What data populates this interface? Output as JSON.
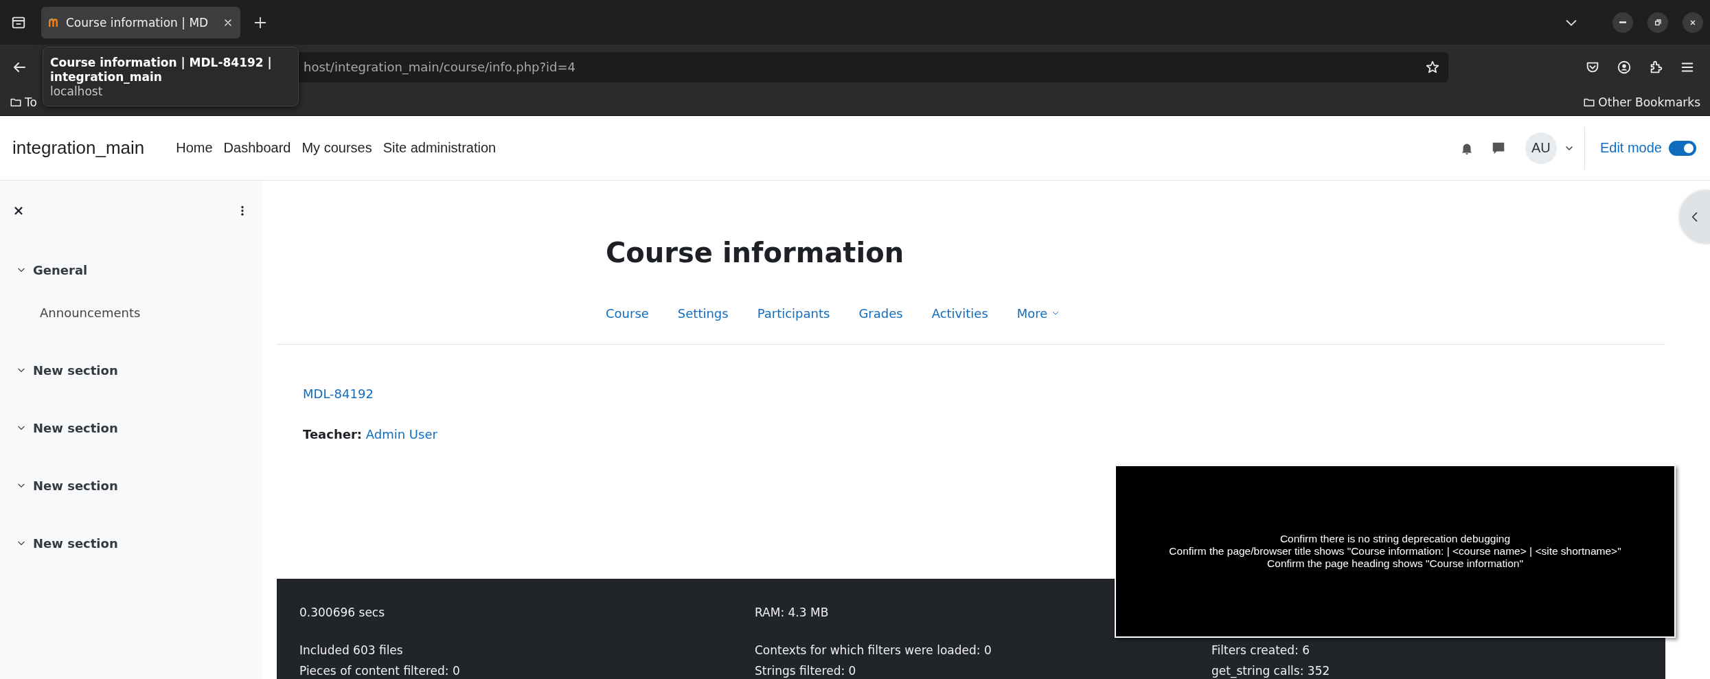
{
  "browser": {
    "tab": {
      "title": "Course information | MD",
      "selected": true
    },
    "tooltip": {
      "title": "Course information | MDL-84192 | integration_main",
      "host": "localhost"
    },
    "url": "host/integration_main/course/info.php?id=4",
    "bookmarks": [
      {
        "label": "To"
      }
    ],
    "other_bookmarks": "Other Bookmarks"
  },
  "navbar": {
    "site_name": "integration_main",
    "links": [
      "Home",
      "Dashboard",
      "My courses",
      "Site administration"
    ],
    "avatar": "AU",
    "edit_mode": {
      "label": "Edit mode",
      "on": true
    }
  },
  "drawer": {
    "sections": [
      {
        "title": "General",
        "expanded": true,
        "children": [
          {
            "title": "Announcements"
          }
        ]
      },
      {
        "title": "New section",
        "expanded": true
      },
      {
        "title": "New section",
        "expanded": true
      },
      {
        "title": "New section",
        "expanded": true
      },
      {
        "title": "New section",
        "expanded": true
      }
    ]
  },
  "page": {
    "heading": "Course information",
    "tabs": [
      {
        "label": "Course",
        "kind": "link"
      },
      {
        "label": "Settings",
        "kind": "link"
      },
      {
        "label": "Participants",
        "kind": "link"
      },
      {
        "label": "Grades",
        "kind": "link"
      },
      {
        "label": "Activities",
        "kind": "link"
      },
      {
        "label": "More",
        "kind": "menu"
      }
    ],
    "course_link": "MDL-84192",
    "teacher": {
      "label": "Teacher:",
      "name": "Admin User"
    }
  },
  "footer": {
    "rows": [
      [
        "0.300696 secs",
        "RAM: 4.3 MB"
      ],
      [
        "Included 603 files",
        "Contexts for which filters were loaded: 0",
        "Filters created: 6"
      ],
      [
        "Pieces of content filtered: 0",
        "Strings filtered: 0",
        "get_string calls: 352"
      ]
    ]
  },
  "overlay": {
    "lines": [
      "Confirm there is no string deprecation debugging",
      "Confirm the page/browser title shows \"Course information: | <course name> | <site shortname>\"",
      "Confirm the page heading shows \"Course information\""
    ]
  }
}
